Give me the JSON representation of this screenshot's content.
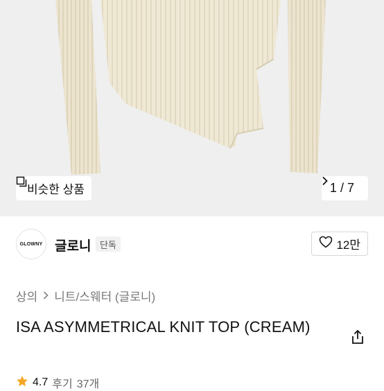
{
  "hero": {
    "similar_button_label": "비슷한 상품",
    "pager": {
      "current": "1",
      "separator": "/",
      "total": "7"
    }
  },
  "brand": {
    "logo_text": "GLOWNY",
    "name": "글로니",
    "badge": "단독",
    "like_count": "12만"
  },
  "breadcrumb": {
    "items": [
      "상의",
      "니트/스웨터 (글로니)"
    ]
  },
  "product": {
    "title": "ISA ASYMMETRICAL KNIT TOP (CREAM)"
  },
  "rating": {
    "score": "4.7",
    "review_label": "후기",
    "review_count": "37개"
  },
  "colors": {
    "hero_bg": "#efefef",
    "knit": "#efe8d4",
    "star": "#f5a623"
  },
  "icons": {
    "similar": "similar-items-icon",
    "pager_next": "chevron-right-icon",
    "like": "heart-icon",
    "share": "share-icon",
    "star": "star-icon"
  }
}
